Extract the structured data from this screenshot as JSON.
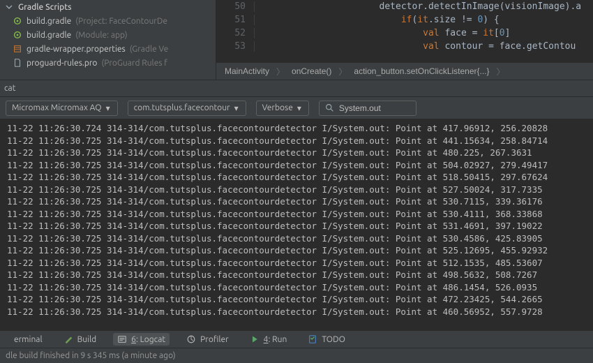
{
  "tree": {
    "header": "Gradle Scripts",
    "items": [
      {
        "name": "build.gradle",
        "ctx": "(Project: FaceContourDe"
      },
      {
        "name": "build.gradle",
        "ctx": "(Module: app)"
      },
      {
        "name": "gradle-wrapper.properties",
        "ctx": "(Gradle Ve"
      },
      {
        "name": "proguard-rules.pro",
        "ctx": "(ProGuard Rules f"
      }
    ]
  },
  "editor": {
    "lines": [
      {
        "no": "50",
        "indent": "                    ",
        "raw_html": "detector.detectInImage(visionImage).a"
      },
      {
        "no": "51",
        "indent": "                        ",
        "raw_html": "<span class='kw'>if</span>(<span class='kw'>it</span>.size != <span class='num'>0</span>) <span class='op'>{</span>"
      },
      {
        "no": "52",
        "indent": "                            ",
        "raw_html": "<span class='kw'>val</span> face = <span class='kw'>it</span>[<span class='num'>0</span>]"
      },
      {
        "no": "53",
        "indent": "                            ",
        "raw_html": "<span class='kw'>val</span> contour = face.getContou"
      }
    ],
    "crumbs": [
      "MainActivity",
      "onCreate()",
      "action_button.setOnClickListener{...}"
    ]
  },
  "logcat": {
    "title": "cat",
    "device": "Micromax Micromax AQ",
    "process": "com.tutsplus.facecontour",
    "level": "Verbose",
    "search_value": "System.out",
    "prefix_date": "11-22 ",
    "prefix_proc": " 314-314/com.tutsplus.facecontourdetector I/System.out: Point at ",
    "rows": [
      {
        "t": "11:26:30.724",
        "x": "417.96912",
        "y": "256.20828"
      },
      {
        "t": "11:26:30.725",
        "x": "441.15634",
        "y": "258.84714"
      },
      {
        "t": "11:26:30.725",
        "x": "480.225",
        "y": "267.3631"
      },
      {
        "t": "11:26:30.725",
        "x": "504.02927",
        "y": "279.49417"
      },
      {
        "t": "11:26:30.725",
        "x": "518.50415",
        "y": "297.67624"
      },
      {
        "t": "11:26:30.725",
        "x": "527.50024",
        "y": "317.7335"
      },
      {
        "t": "11:26:30.725",
        "x": "530.7115",
        "y": "339.36176"
      },
      {
        "t": "11:26:30.725",
        "x": "530.4111",
        "y": "368.33868"
      },
      {
        "t": "11:26:30.725",
        "x": "531.4691",
        "y": "397.19022"
      },
      {
        "t": "11:26:30.725",
        "x": "530.4586",
        "y": "425.83905"
      },
      {
        "t": "11:26:30.725",
        "x": "525.12695",
        "y": "455.92932"
      },
      {
        "t": "11:26:30.725",
        "x": "512.1535",
        "y": "485.53607"
      },
      {
        "t": "11:26:30.725",
        "x": "498.5632",
        "y": "508.7267"
      },
      {
        "t": "11:26:30.725",
        "x": "486.1454",
        "y": "526.0935"
      },
      {
        "t": "11:26:30.725",
        "x": "472.23425",
        "y": "544.2665"
      },
      {
        "t": "11:26:30.725",
        "x": "460.56952",
        "y": "557.9728"
      }
    ]
  },
  "tooltabs": {
    "terminal": "erminal",
    "build": "Build",
    "logcat": "6: Logcat",
    "profiler": "Profiler",
    "run": "4: Run",
    "todo": "TODO"
  },
  "status": "dle build finished in 9 s 345 ms (a minute ago)"
}
